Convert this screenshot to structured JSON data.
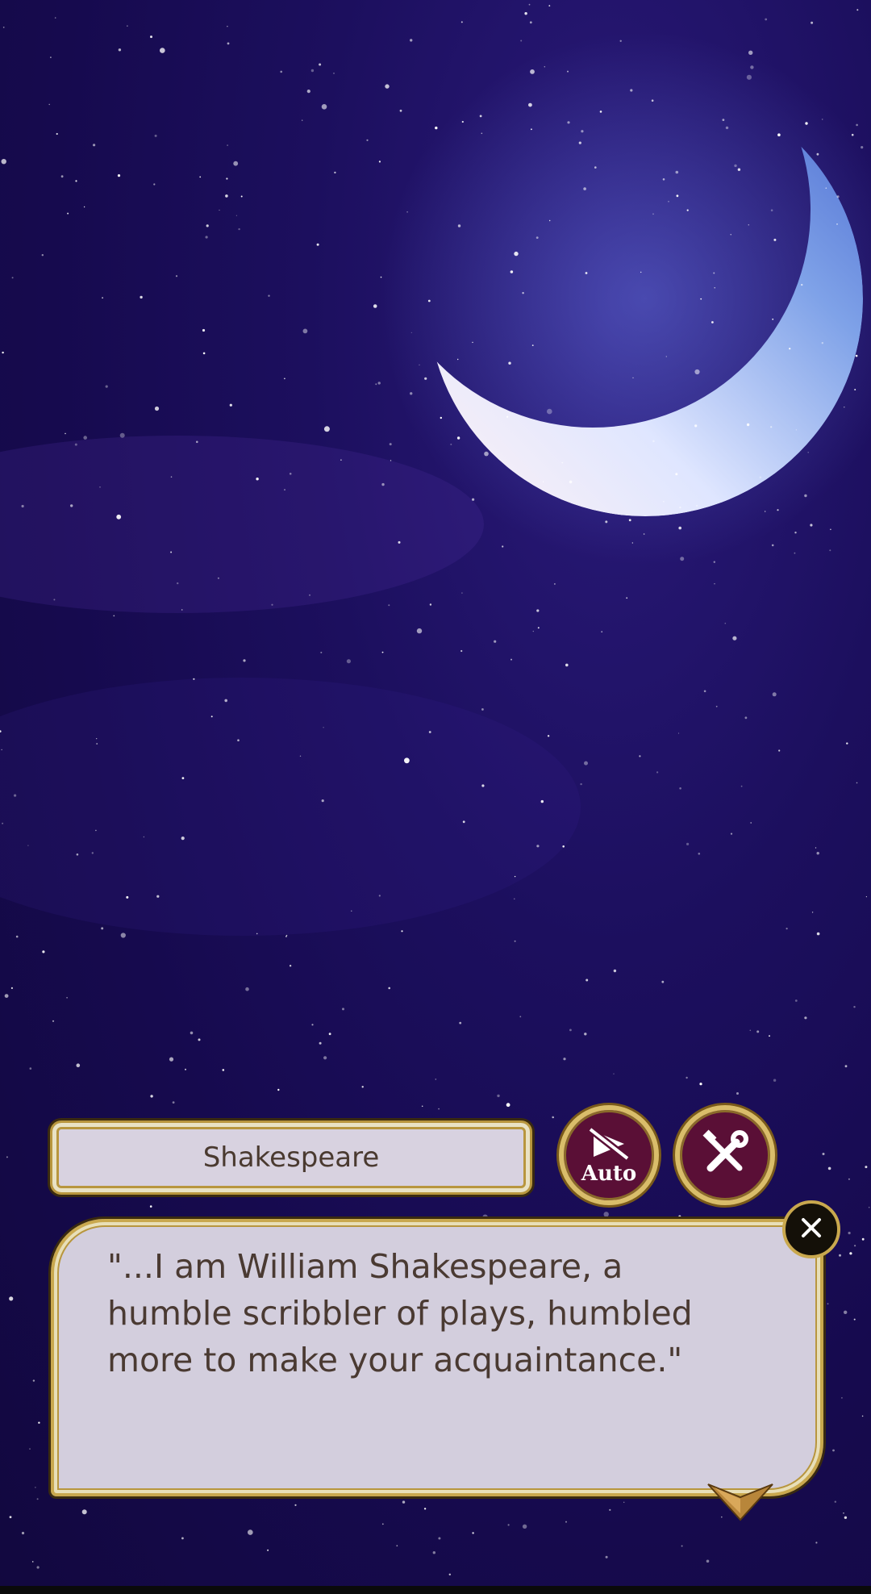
{
  "speaker": {
    "name": "Shakespeare"
  },
  "dialog": {
    "text": "\"...I am William Shakespeare, a humble scribbler of plays, humbled more to make your acquaintance.\""
  },
  "controls": {
    "auto_label": "Auto",
    "auto_icon": "auto-play-off-icon",
    "settings_icon": "wrench-screwdriver-icon",
    "close_icon": "close-x-icon",
    "next_icon": "chevron-down-icon"
  },
  "colors": {
    "sky": "#1c0f5e",
    "panel": "#d3cedd",
    "gold_border": "#c9a84e",
    "button_fill": "#5a0f36",
    "text": "#4a3a32"
  }
}
